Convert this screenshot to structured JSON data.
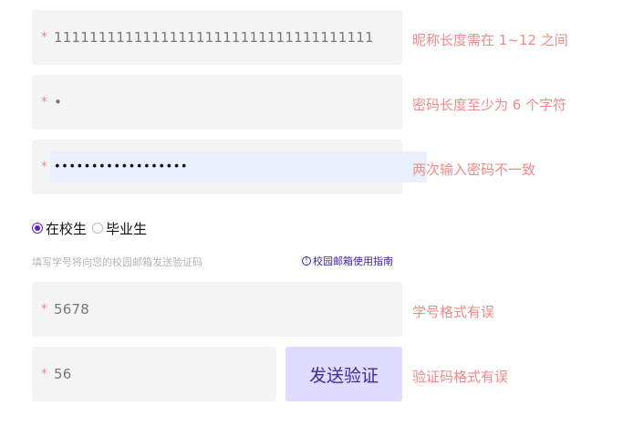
{
  "required_mark": "*",
  "nickname": {
    "value": "111111111111111111111111111111111111",
    "error": "昵称长度需在 1~12 之间"
  },
  "password": {
    "value": "•",
    "error": "密码长度至少为 6 个字符"
  },
  "confirm_password": {
    "value": "••••••••••••••••••",
    "error": "两次输入密码不一致"
  },
  "identity": {
    "options": [
      {
        "label": "在校生",
        "selected": true
      },
      {
        "label": "毕业生",
        "selected": false
      }
    ]
  },
  "hint": "填写学号将向您的校园邮箱发送验证码",
  "guide_icon": "info-icon",
  "guide_link": "校园邮箱使用指南",
  "student_id": {
    "value": "5678",
    "error": "学号格式有误"
  },
  "verify_code": {
    "value": "56",
    "error": "验证码格式有误",
    "send_label": "发送验证"
  },
  "colors": {
    "error": "#f08a8a",
    "accent": "#5b1ec9",
    "field_bg": "#f4f4f4",
    "button_bg": "#e0dcff"
  }
}
